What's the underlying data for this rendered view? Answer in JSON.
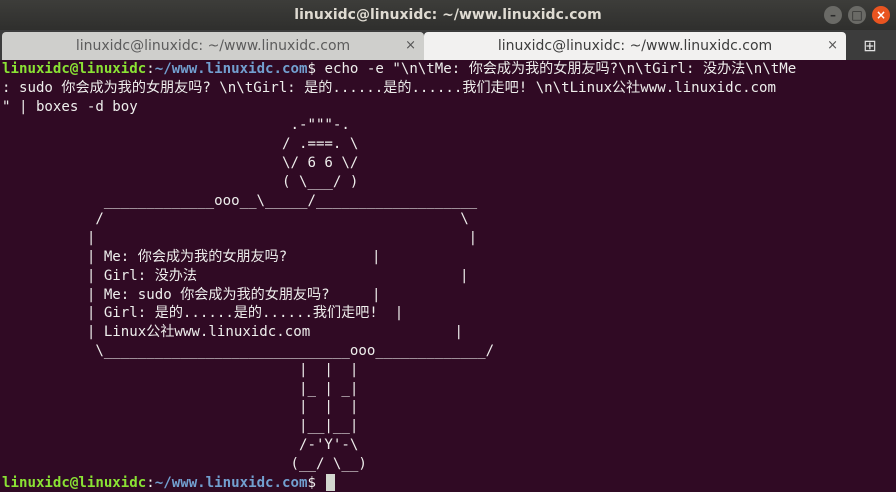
{
  "window": {
    "title": "linuxidc@linuxidc: ~/www.linuxidc.com",
    "minimize_glyph": "–",
    "maximize_glyph": "□",
    "close_glyph": "×"
  },
  "tabs": [
    {
      "label": "linuxidc@linuxidc: ~/www.linuxidc.com",
      "active": false
    },
    {
      "label": "linuxidc@linuxidc: ~/www.linuxidc.com",
      "active": true
    }
  ],
  "tab_close_glyph": "×",
  "new_tab_glyph": "⊞",
  "prompt": {
    "user": "linuxidc@linuxidc",
    "sep": ":",
    "path": "~/www.linuxidc.com",
    "sign": "$"
  },
  "command_lines": [
    " echo -e \"\\n\\tMe: 你会成为我的女朋友吗?\\n\\tGirl: 没办法\\n\\tMe",
    ": sudo 你会成为我的女朋友吗? \\n\\tGirl: 是的......是的......我们走吧! \\n\\tLinux公社www.linuxidc.com",
    "\" | boxes -d boy"
  ],
  "output_lines": [
    "                                  .-\"\"\"-.",
    "                                 / .===. \\",
    "                                 \\/ 6 6 \\/",
    "                                 ( \\___/ )",
    "            _____________ooo__\\_____/___________________",
    "           /                                          \\",
    "          |                                            |",
    "          | Me: 你会成为我的女朋友吗?          |",
    "          | Girl: 没办法                               |",
    "          | Me: sudo 你会成为我的女朋友吗?     |",
    "          | Girl: 是的......是的......我们走吧!  |",
    "          | Linux公社www.linuxidc.com                 |",
    "           \\_____________________________ooo_____________/",
    "                                   |  |  |",
    "                                   |_ | _|",
    "                                   |  |  |",
    "                                   |__|__|",
    "                                   /-'Y'-\\",
    "                                  (__/ \\__)"
  ]
}
